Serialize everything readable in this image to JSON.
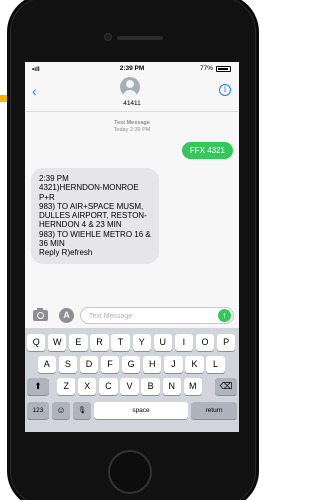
{
  "status_bar": {
    "signal": "•ıll",
    "time": "2:39 PM",
    "battery": "77%"
  },
  "conversation": {
    "back": "‹",
    "contact": "41411",
    "info": "i"
  },
  "meta": {
    "label": "Text Message",
    "timestamp": "Today 2:39 PM"
  },
  "messages": {
    "sent": "FFX 4321",
    "received": "2:39 PM\n4321)HERNDON-MONROE P+R\n983) TO AIR+SPACE MUSM, DULLES AIRPORT, RESTON-HERNDON 4 & 23 MIN\n983) TO WIEHLE METRO 16 & 36 MIN\nReply R)efresh"
  },
  "input": {
    "placeholder": "Text Message",
    "value": "",
    "send_symbol": "↑",
    "apps_symbol": "A"
  },
  "keyboard": {
    "row1": [
      "Q",
      "W",
      "E",
      "R",
      "T",
      "Y",
      "U",
      "I",
      "O",
      "P"
    ],
    "row2": [
      "A",
      "S",
      "D",
      "F",
      "G",
      "H",
      "J",
      "K",
      "L"
    ],
    "row3": [
      "Z",
      "X",
      "C",
      "V",
      "B",
      "N",
      "M"
    ],
    "shift": "⬆",
    "delete": "⌫",
    "numbers": "123",
    "emoji": "☺",
    "mic": "🎙",
    "space": "space",
    "return": "return"
  },
  "colors": {
    "accent": "#f5b400",
    "sent_bubble": "#34c759",
    "received_bubble": "#e5e5ea",
    "link": "#1a7cf5"
  }
}
